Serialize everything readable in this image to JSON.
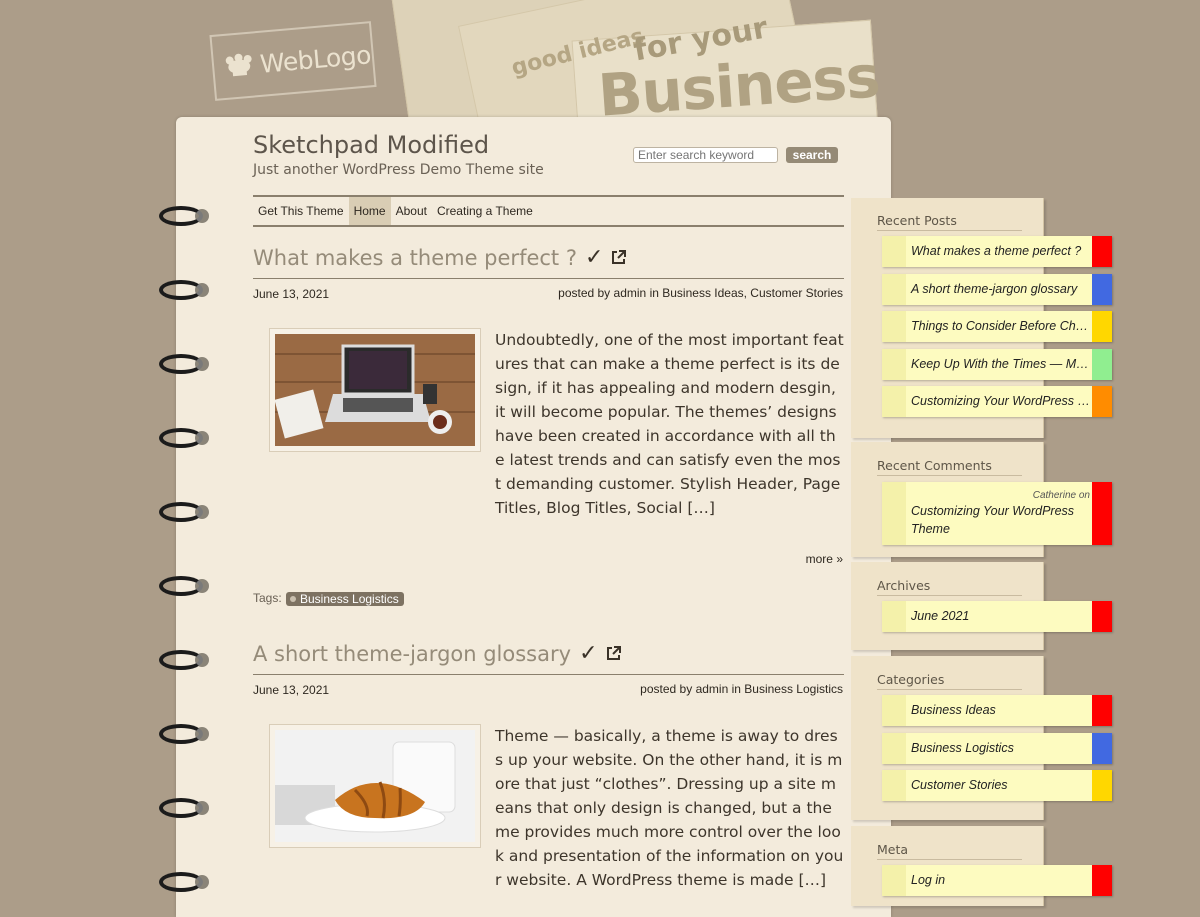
{
  "logo": {
    "text": "WebLogo"
  },
  "header_art": {
    "word1": "good ideas",
    "word2": "for your",
    "word3": "Business"
  },
  "site": {
    "title": "Sketchpad Modified",
    "description": "Just another WordPress Demo Theme site"
  },
  "search": {
    "placeholder": "Enter search keyword",
    "button": "search"
  },
  "nav": {
    "items": [
      "Get This Theme",
      "Home",
      "About",
      "Creating a Theme"
    ],
    "active": "Home"
  },
  "posts": [
    {
      "title": "What makes a theme perfect ?",
      "check": "✓",
      "date": "June 13, 2021",
      "posted_by_label": "posted by",
      "author": "admin",
      "in_label": "in",
      "categories": "Business Ideas, Customer Stories",
      "excerpt": "Undoubtedly, one of the most important features that can make a theme perfect is its design, if it has appealing and modern desgin, it will become popular. The themes’ designs have been created in accordance with all the latest trends and can satisfy even the most demanding customer. Stylish Header, Page Titles, Blog Titles, Social […]",
      "more": "more »",
      "tags_label": "Tags:",
      "tag": "Business Logistics"
    },
    {
      "title": "A short theme-jargon glossary",
      "check": "✓",
      "date": "June 13, 2021",
      "posted_by_label": "posted by",
      "author": "admin",
      "in_label": "in",
      "categories": "Business Logistics",
      "excerpt": "Theme — basically, a theme is away to dress up your website. On the other hand, it is more that just “clothes”. Dressing up a site means that only design is changed, but a theme provides much more control over the look and presentation of the information on your website. A WordPress theme is made […]"
    }
  ],
  "sidebar": {
    "recent_posts": {
      "title": "Recent Posts",
      "items": [
        {
          "label": "What makes a theme perfect ?",
          "color": "#ff0000"
        },
        {
          "label": "A short theme-jargon glossary",
          "color": "#4169e1"
        },
        {
          "label": "Things to Consider Before Ch…",
          "color": "#ffd700"
        },
        {
          "label": "Keep Up With the Times — M…",
          "color": "#90ee90"
        },
        {
          "label": "Customizing Your WordPress …",
          "color": "#ff8c00"
        }
      ]
    },
    "recent_comments": {
      "title": "Recent Comments",
      "author": "Catherine",
      "on_label": "on",
      "post": "Customizing Your WordPress Theme",
      "color": "#ff0000"
    },
    "archives": {
      "title": "Archives",
      "items": [
        {
          "label": "June 2021",
          "color": "#ff0000"
        }
      ]
    },
    "categories": {
      "title": "Categories",
      "items": [
        {
          "label": "Business Ideas",
          "color": "#ff0000"
        },
        {
          "label": "Business Logistics",
          "color": "#4169e1"
        },
        {
          "label": "Customer Stories",
          "color": "#ffd700"
        }
      ]
    },
    "meta": {
      "title": "Meta",
      "items": [
        {
          "label": "Log in",
          "color": "#ff0000"
        }
      ]
    }
  }
}
